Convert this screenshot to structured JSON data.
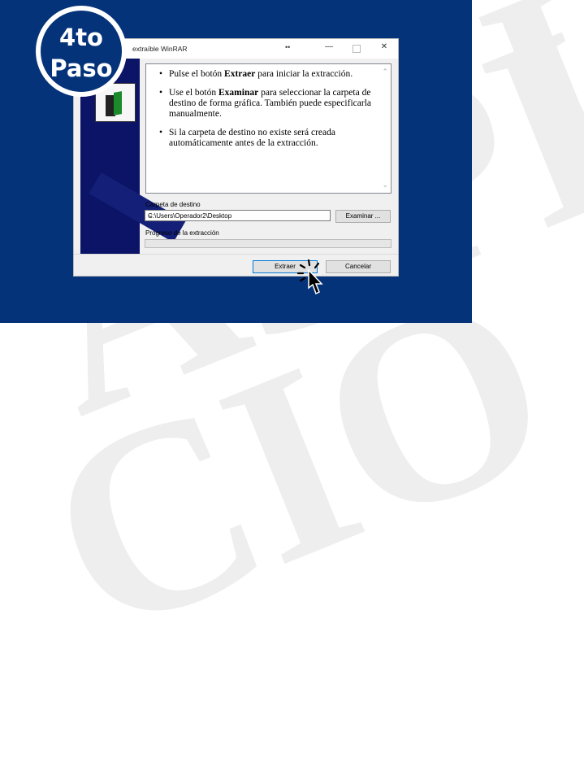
{
  "badge": {
    "line1": "4to",
    "line2": "Paso"
  },
  "watermark": {
    "line1": "ASPI",
    "line2": "CIO",
    "side": "U"
  },
  "window": {
    "title": "extraíble WinRAR",
    "title_dots": "••",
    "controls": {
      "minimize": "—",
      "close": "✕"
    },
    "bullets": [
      {
        "pre": "Pulse el botón ",
        "bold": "Extraer",
        "post": " para iniciar la extracción."
      },
      {
        "pre": "Use el botón ",
        "bold": "Examinar",
        "post": " para seleccionar la carpeta de destino de forma gráfica. También puede especificarla manualmente."
      },
      {
        "pre": "Si la carpeta de destino no existe será creada automáticamente antes de la extracción.",
        "bold": "",
        "post": ""
      }
    ],
    "dest_label": "Carpeta de destino",
    "dest_value": "C:\\Users\\Operador2\\Desktop",
    "browse_label": "Examinar ...",
    "progress_label": "Progreso de la extracción",
    "progress": 0,
    "extract_label": "Extraer",
    "cancel_label": "Cancelar"
  },
  "colors": {
    "panel": "#05337a",
    "sidebar": "#0b1466",
    "accent": "#0078d7"
  },
  "icons": {
    "dropdown": "chevron-down-icon",
    "cursor": "hand-pointer-icon"
  }
}
